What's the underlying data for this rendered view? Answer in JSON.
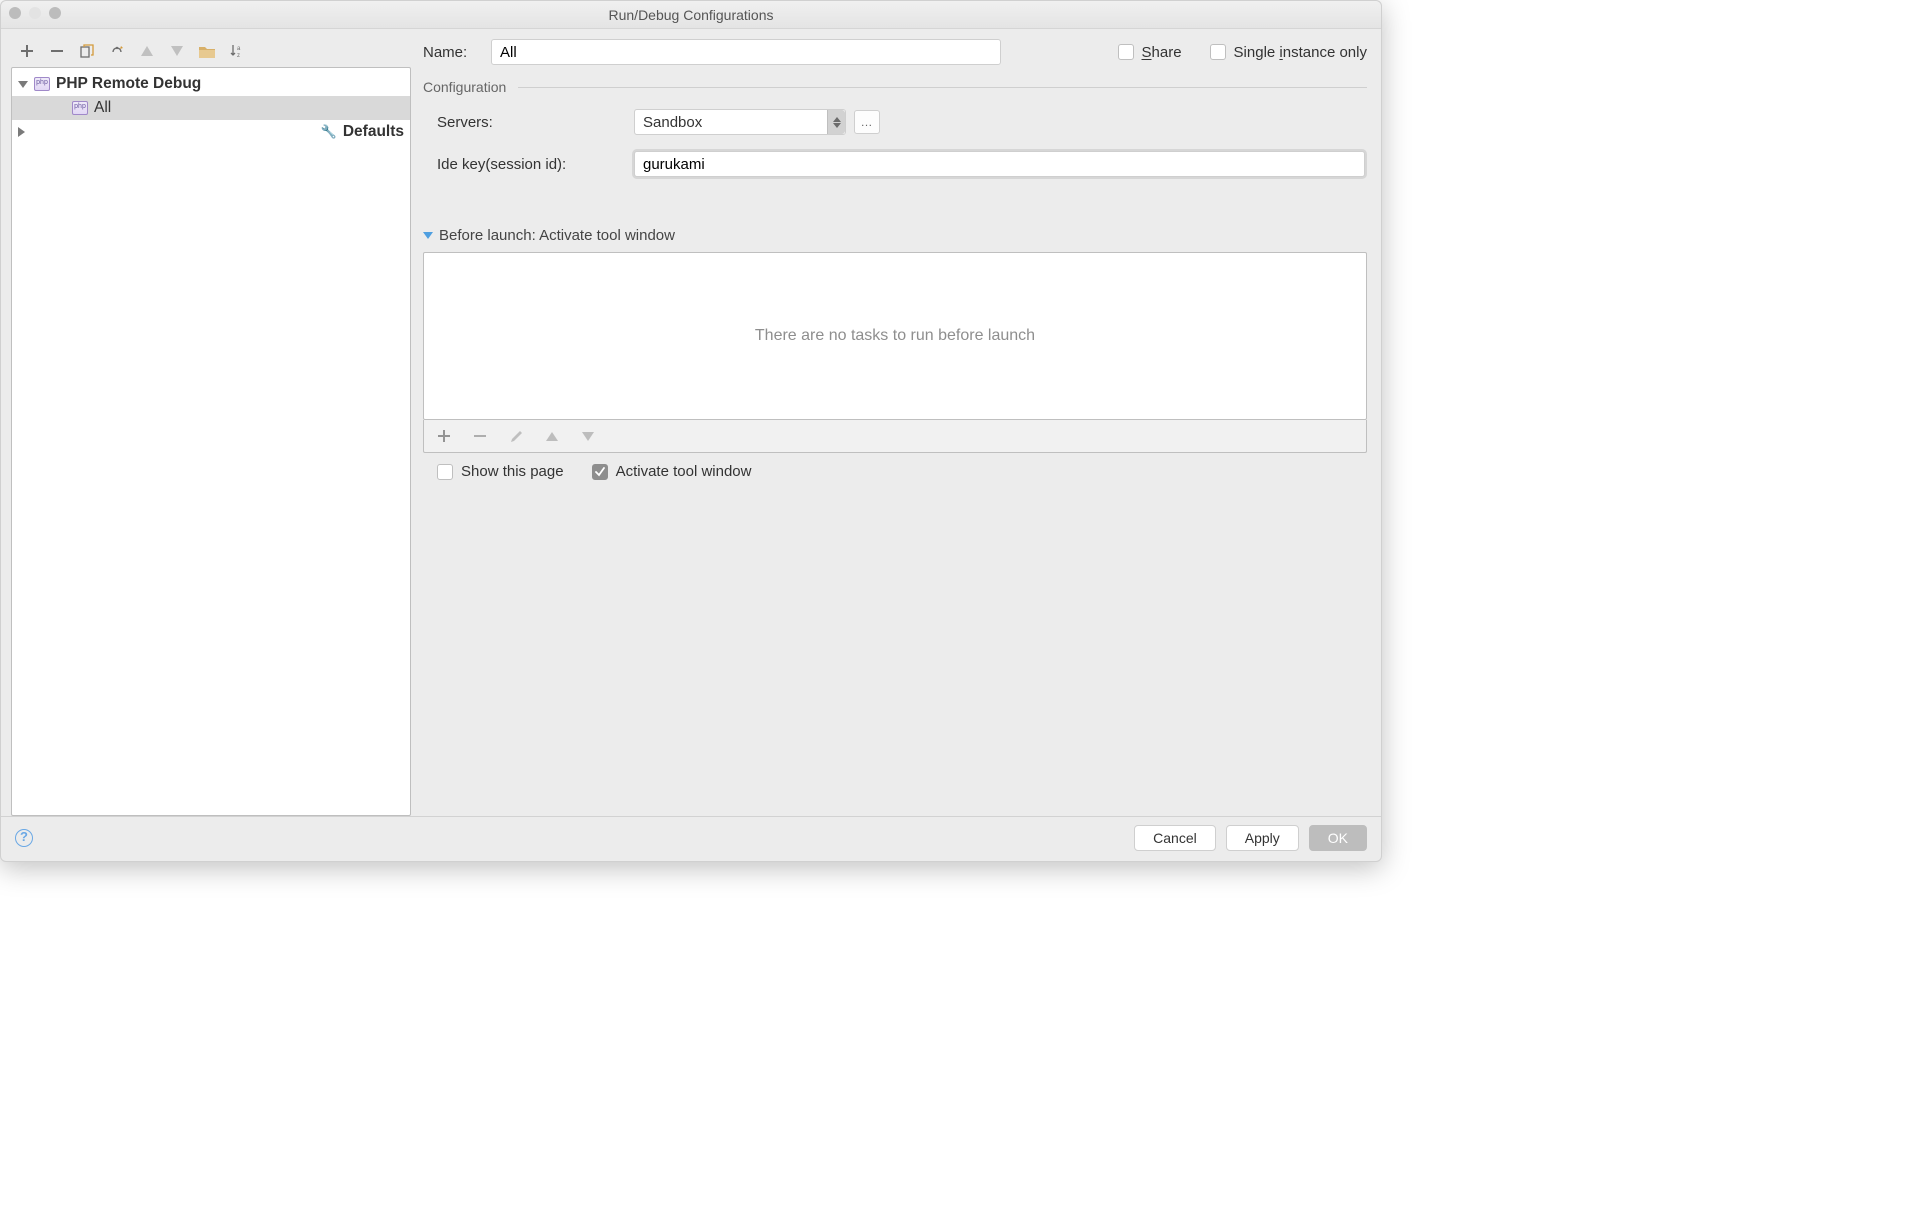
{
  "window": {
    "title": "Run/Debug Configurations"
  },
  "left_toolbar": {
    "add": "+",
    "remove": "−"
  },
  "tree": {
    "root1": {
      "label": "PHP Remote Debug",
      "expanded": true,
      "children": [
        {
          "label": "All",
          "selected": true
        }
      ]
    },
    "root2": {
      "label": "Defaults",
      "expanded": false
    }
  },
  "form": {
    "name_label": "Name:",
    "name_value": "All",
    "share_label": "Share",
    "single_instance_label": "Single instance only",
    "configuration_header": "Configuration",
    "servers_label": "Servers:",
    "servers_value": "Sandbox",
    "idekey_label": "Ide key(session id):",
    "idekey_value": "gurukami",
    "before_launch_header": "Before launch: Activate tool window",
    "tasks_empty": "There are no tasks to run before launch",
    "show_this_page_label": "Show this page",
    "activate_tool_window_label": "Activate tool window"
  },
  "footer": {
    "cancel": "Cancel",
    "apply": "Apply",
    "ok": "OK"
  }
}
